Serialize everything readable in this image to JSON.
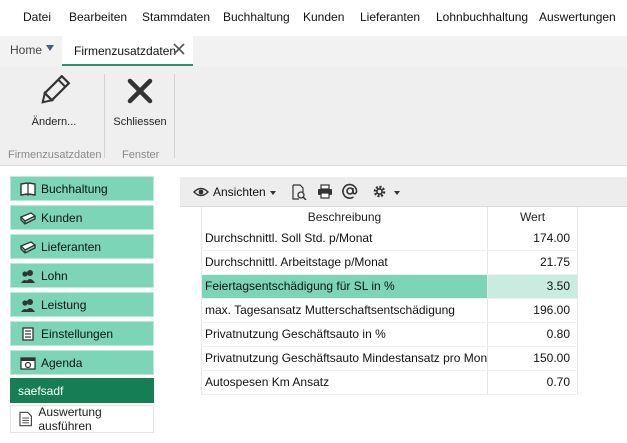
{
  "menu": [
    "Datei",
    "Bearbeiten",
    "Stammdaten",
    "Buchhaltung",
    "Kunden",
    "Lieferanten",
    "Lohnbuchhaltung",
    "Auswertungen"
  ],
  "tabs": {
    "home": "Home",
    "active": "Firmenzusatzdaten"
  },
  "ribbon": {
    "edit_label": "Ändern...",
    "close_label": "Schliessen",
    "group1": "Firmenzusatzdaten",
    "group2": "Fenster"
  },
  "sidebar": {
    "items": [
      {
        "label": "Buchhaltung",
        "icon": "book-icon"
      },
      {
        "label": "Kunden",
        "icon": "books-icon"
      },
      {
        "label": "Lieferanten",
        "icon": "books-icon"
      },
      {
        "label": "Lohn",
        "icon": "people-icon"
      },
      {
        "label": "Leistung",
        "icon": "people-icon"
      },
      {
        "label": "Einstellungen",
        "icon": "list-icon"
      },
      {
        "label": "Agenda",
        "icon": "calendar-icon"
      }
    ],
    "active": "saefsadf",
    "action": "Auswertung ausführen"
  },
  "toolbar": {
    "views_label": "Ansichten"
  },
  "table": {
    "headers": [
      "Beschreibung",
      "Wert"
    ],
    "rows": [
      [
        "Durchschnittl. Soll Std. p/Monat",
        "174.00"
      ],
      [
        "Durchschnittl. Arbeitstage p/Monat",
        "21.75"
      ],
      [
        "Feiertagsentschädigung für SL in %",
        "3.50"
      ],
      [
        "max. Tagesansatz Mutterschaftsentschädigung",
        "196.00"
      ],
      [
        "Privatnutzung Geschäftsauto in %",
        "0.80"
      ],
      [
        "Privatnutzung Geschäftsauto Mindestansatz pro Monat",
        "150.00"
      ],
      [
        "Autospesen Km Ansatz",
        "0.70"
      ]
    ],
    "selected_index": 2
  },
  "colors": {
    "accent": "#2e8f6a",
    "nav": "#7dd5b8",
    "nav_active": "#167e55"
  }
}
